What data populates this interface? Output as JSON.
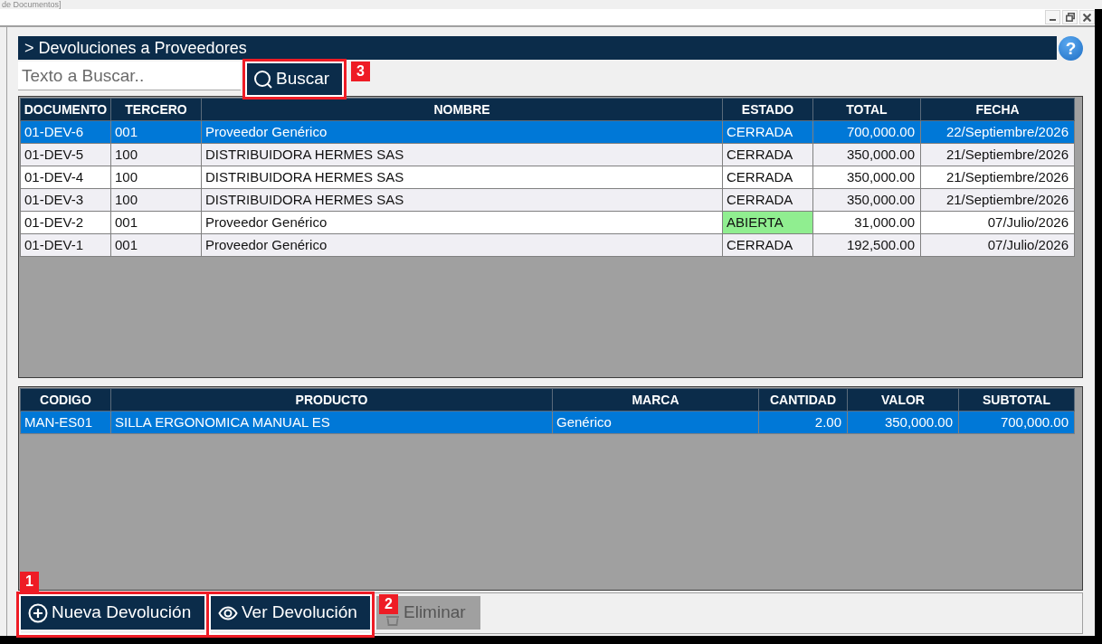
{
  "window": {
    "title": "de Documentos]"
  },
  "panel": {
    "title": "> Devoluciones a Proveedores",
    "help": "?"
  },
  "search": {
    "placeholder": "Texto a Buscar..",
    "button": {
      "label": "Buscar",
      "callout": {
        "number": "3",
        "badge_above": false
      }
    }
  },
  "documents_table": {
    "columns": [
      "DOCUMENTO",
      "TERCERO",
      "NOMBRE",
      "ESTADO",
      "TOTAL",
      "FECHA"
    ],
    "rows": [
      {
        "selected": true,
        "status_highlighted": false,
        "cells": [
          "01-DEV-6",
          "001",
          "Proveedor Genérico",
          "CERRADA",
          "700,000.00",
          "22/Septiembre/2026"
        ]
      },
      {
        "selected": false,
        "status_highlighted": false,
        "cells": [
          "01-DEV-5",
          "100",
          "DISTRIBUIDORA HERMES SAS",
          "CERRADA",
          "350,000.00",
          "21/Septiembre/2026"
        ]
      },
      {
        "selected": false,
        "status_highlighted": false,
        "cells": [
          "01-DEV-4",
          "100",
          "DISTRIBUIDORA HERMES SAS",
          "CERRADA",
          "350,000.00",
          "21/Septiembre/2026"
        ]
      },
      {
        "selected": false,
        "status_highlighted": false,
        "cells": [
          "01-DEV-3",
          "100",
          "DISTRIBUIDORA HERMES SAS",
          "CERRADA",
          "350,000.00",
          "21/Septiembre/2026"
        ]
      },
      {
        "selected": false,
        "status_highlighted": true,
        "cells": [
          "01-DEV-2",
          "001",
          "Proveedor Genérico",
          "ABIERTA",
          "31,000.00",
          "07/Julio/2026"
        ]
      },
      {
        "selected": false,
        "status_highlighted": false,
        "cells": [
          "01-DEV-1",
          "001",
          "Proveedor Genérico",
          "CERRADA",
          "192,500.00",
          "07/Julio/2026"
        ]
      }
    ]
  },
  "items_table": {
    "columns": [
      "CODIGO",
      "PRODUCTO",
      "MARCA",
      "CANTIDAD",
      "VALOR",
      "SUBTOTAL"
    ],
    "rows": [
      {
        "selected": true,
        "cells": [
          "MAN-ES01",
          "SILLA ERGONOMICA MANUAL ES",
          "Genérico",
          "2.00",
          "350,000.00",
          "700,000.00"
        ]
      }
    ]
  },
  "actions": [
    {
      "kind": "add",
      "label": "Nueva Devolución",
      "disabled": false,
      "callout": {
        "number": "1",
        "badge_above": true
      }
    },
    {
      "kind": "view",
      "label": "Ver Devolución",
      "disabled": false,
      "callout": {
        "number": "2",
        "badge_above": false
      }
    },
    {
      "kind": "delete",
      "label": "Eliminar",
      "disabled": true
    }
  ]
}
